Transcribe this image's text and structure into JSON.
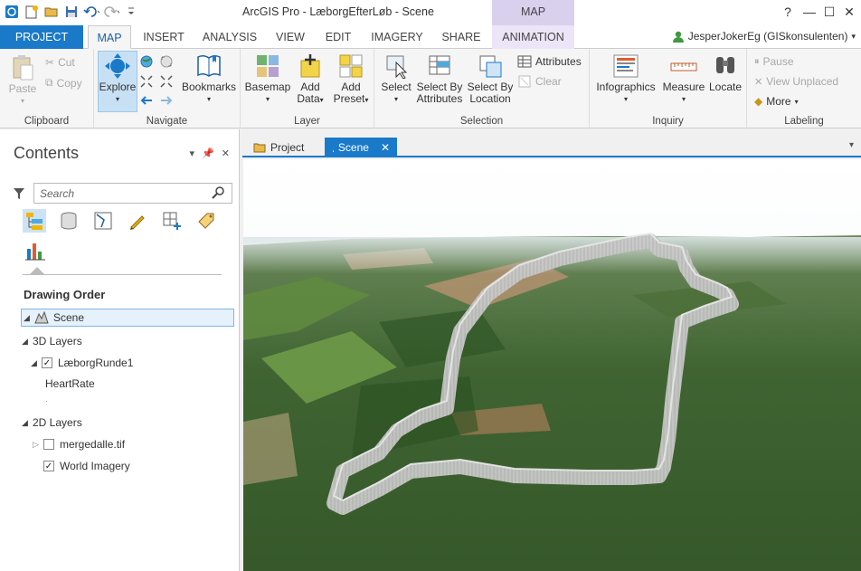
{
  "window": {
    "title": "ArcGIS Pro - LæborgEfterLøb - Scene",
    "context_tab_header": "MAP",
    "help": "?",
    "minimize": "—",
    "maximize": "☐",
    "close": "✕"
  },
  "tabs": [
    "PROJECT",
    "MAP",
    "INSERT",
    "ANALYSIS",
    "VIEW",
    "EDIT",
    "IMAGERY",
    "SHARE",
    "ANIMATION"
  ],
  "user": "JesperJokerEg (GISkonsulenten)",
  "ribbon": {
    "clipboard": {
      "label": "Clipboard",
      "paste": "Paste",
      "cut": "Cut",
      "copy": "Copy"
    },
    "navigate": {
      "label": "Navigate",
      "explore": "Explore",
      "bookmarks": "Bookmarks"
    },
    "layer": {
      "label": "Layer",
      "basemap": "Basemap",
      "add_data_1": "Add",
      "add_data_2": "Data",
      "add_preset_1": "Add",
      "add_preset_2": "Preset"
    },
    "selection": {
      "label": "Selection",
      "select": "Select",
      "select_by_attr_1": "Select By",
      "select_by_attr_2": "Attributes",
      "select_by_loc_1": "Select By",
      "select_by_loc_2": "Location",
      "attributes": "Attributes",
      "clear": "Clear"
    },
    "inquiry": {
      "label": "Inquiry",
      "infographics": "Infographics",
      "measure": "Measure",
      "locate": "Locate"
    },
    "labeling": {
      "label": "Labeling",
      "pause": "Pause",
      "view_unplaced": "View Unplaced",
      "more": "More"
    }
  },
  "contents": {
    "title": "Contents",
    "search_placeholder": "Search",
    "drawing_order": "Drawing Order",
    "scene": "Scene",
    "layers_3d": "3D Layers",
    "layer_1": "LæborgRunde1",
    "layer_1_sub": "HeartRate",
    "layer_1_sub_dot": "·",
    "layers_2d": "2D Layers",
    "layer_2": "mergedalle.tif",
    "layer_3": "World Imagery"
  },
  "view_tabs": {
    "project": "Project",
    "scene": "Scene"
  },
  "colors": {
    "accent": "#1a7ac9",
    "context": "#d9d0ee",
    "selected": "#c7e0f4"
  }
}
